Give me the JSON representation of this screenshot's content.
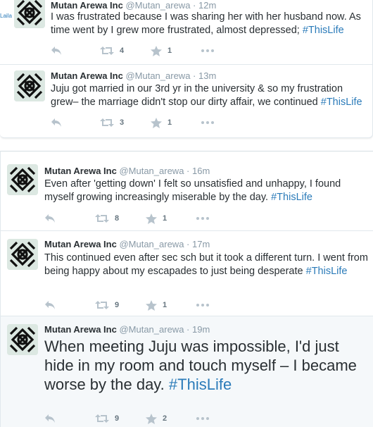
{
  "tweets": [
    {
      "name": "Mutan Arewa Inc",
      "handle": "@Mutan_arewa",
      "time": "12m",
      "text": "I was frustrated because I was sharing her with her husband now. As time went by I grew more frustrated, almost depressed;",
      "hashtag": "#ThisLife",
      "retweets": "4",
      "favorites": "1"
    },
    {
      "name": "Mutan Arewa Inc",
      "handle": "@Mutan_arewa",
      "time": "13m",
      "text": "Juju got married in our 3rd yr in the university & so my frustration grew– the marriage didn't stop our dirty affair, we continued",
      "hashtag": "#ThisLife",
      "retweets": "3",
      "favorites": "1"
    },
    {
      "name": "Mutan Arewa Inc",
      "handle": "@Mutan_arewa",
      "time": "16m",
      "text": "Even after 'getting down' I felt so unsatisfied and unhappy, I found myself growing increasingly miserable by the day.",
      "hashtag": "#ThisLife",
      "retweets": "8",
      "favorites": "1"
    },
    {
      "name": "Mutan Arewa Inc",
      "handle": "@Mutan_arewa",
      "time": "17m",
      "text": "This continued even after sec sch but it took a different turn. I went from being happy about my escapades to just being desperate",
      "hashtag": "#ThisLife",
      "retweets": "9",
      "favorites": "1"
    },
    {
      "name": "Mutan Arewa Inc",
      "handle": "@Mutan_arewa",
      "time": "19m",
      "text": "When meeting Juju was impossible, I'd just hide in my room and touch myself – I became worse by the day.",
      "hashtag": "#ThisLife",
      "retweets": "9",
      "favorites": "2"
    }
  ],
  "side_label": "Laila",
  "separator": "·",
  "icons": {
    "reply": "reply-icon",
    "retweet": "retweet-icon",
    "favorite": "star-icon",
    "more": "more-icon"
  },
  "colors": {
    "link": "#2b7bb9",
    "muted": "#8899a6",
    "text": "#292f33",
    "highlight_bg": "#f5f8fa"
  }
}
